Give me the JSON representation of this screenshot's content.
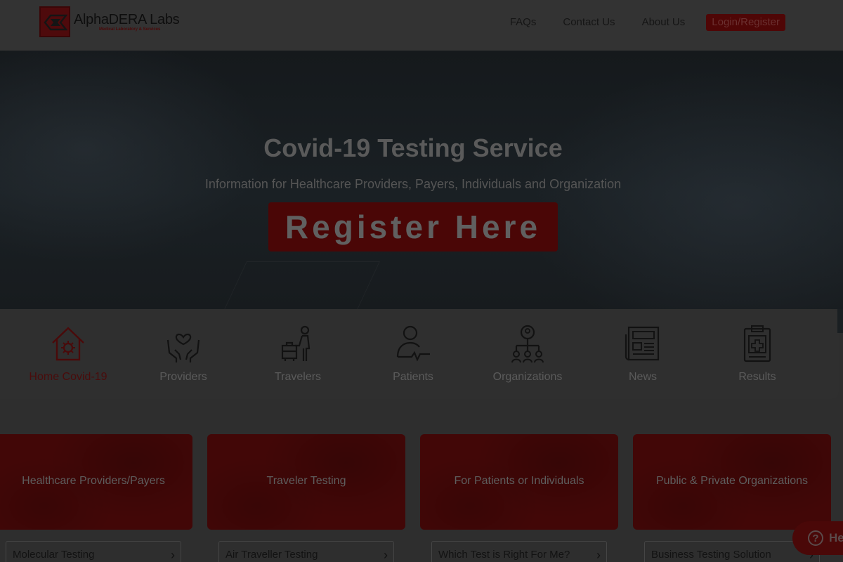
{
  "header": {
    "logo_name": "AlphaDERA Labs",
    "logo_tagline": "Medical Laboratory & Services",
    "nav": [
      {
        "label": "FAQs"
      },
      {
        "label": "Contact Us"
      },
      {
        "label": "About Us"
      }
    ],
    "login_label": "Login/Register"
  },
  "hero": {
    "title": "Covid-19 Testing Service",
    "subtitle": "Information for Healthcare Providers, Payers, Individuals and Organization",
    "register_label": "Register Here"
  },
  "strip": {
    "items": [
      {
        "label": "Home Covid-19",
        "icon": "home-virus-icon",
        "active": true
      },
      {
        "label": "Providers",
        "icon": "hands-heart-icon"
      },
      {
        "label": "Travelers",
        "icon": "traveler-luggage-icon"
      },
      {
        "label": "Patients",
        "icon": "patient-pulse-icon"
      },
      {
        "label": "Organizations",
        "icon": "org-chart-icon"
      },
      {
        "label": "News",
        "icon": "newspaper-icon"
      },
      {
        "label": "Results",
        "icon": "clipboard-medical-icon"
      }
    ]
  },
  "cards": [
    {
      "title": "Healthcare Providers/Payers",
      "button": "Molecular Testing"
    },
    {
      "title": "Traveler Testing",
      "button": "Air Traveller Testing"
    },
    {
      "title": "For Patients or Individuals",
      "button": "Which Test is Right For Me?"
    },
    {
      "title": "Public & Private Organizations",
      "button": "Business Testing Solution"
    }
  ],
  "help": {
    "label": "He",
    "icon": "question-icon"
  },
  "colors": {
    "brand": "#c0141a",
    "overlay": "rgba(0,0,0,0.75)"
  }
}
